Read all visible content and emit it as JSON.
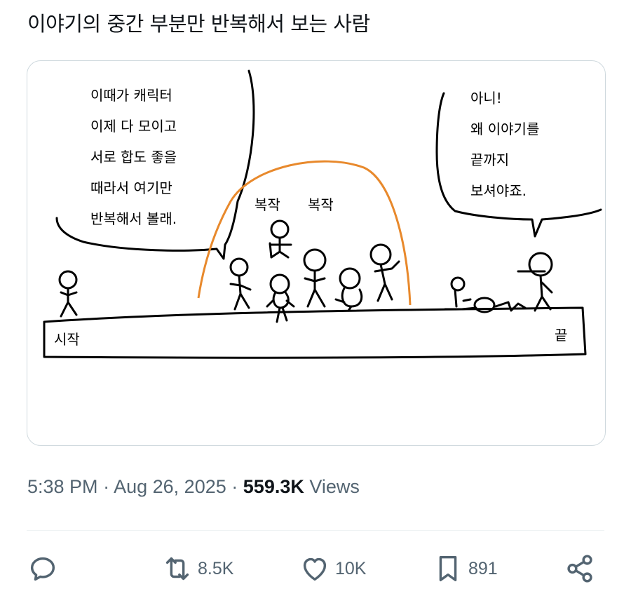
{
  "tweet": {
    "text": "이야기의 중간 부분만 반복해서 보는 사람"
  },
  "comic": {
    "left_bubble": [
      "이때가 캐릭터",
      "이제 다 모이고",
      "서로 합도 좋을",
      "때라서 여기만",
      "반복해서 볼래."
    ],
    "right_bubble": [
      "아니!",
      "왜 이야기를",
      "끝까지",
      "보셔야죠."
    ],
    "sfx_1": "복작",
    "sfx_2": "복작",
    "start_label": "시작",
    "end_label": "끝",
    "arc_color": "#e8892c"
  },
  "meta": {
    "time": "5:38 PM",
    "separator": "·",
    "date": "Aug 26, 2025",
    "views_count": "559.3K",
    "views_label": "Views"
  },
  "actions": {
    "reply_icon": "reply-icon",
    "retweet_icon": "retweet-icon",
    "retweet_count": "8.5K",
    "like_icon": "heart-icon",
    "like_count": "10K",
    "bookmark_icon": "bookmark-icon",
    "bookmark_count": "891",
    "share_icon": "share-icon"
  }
}
